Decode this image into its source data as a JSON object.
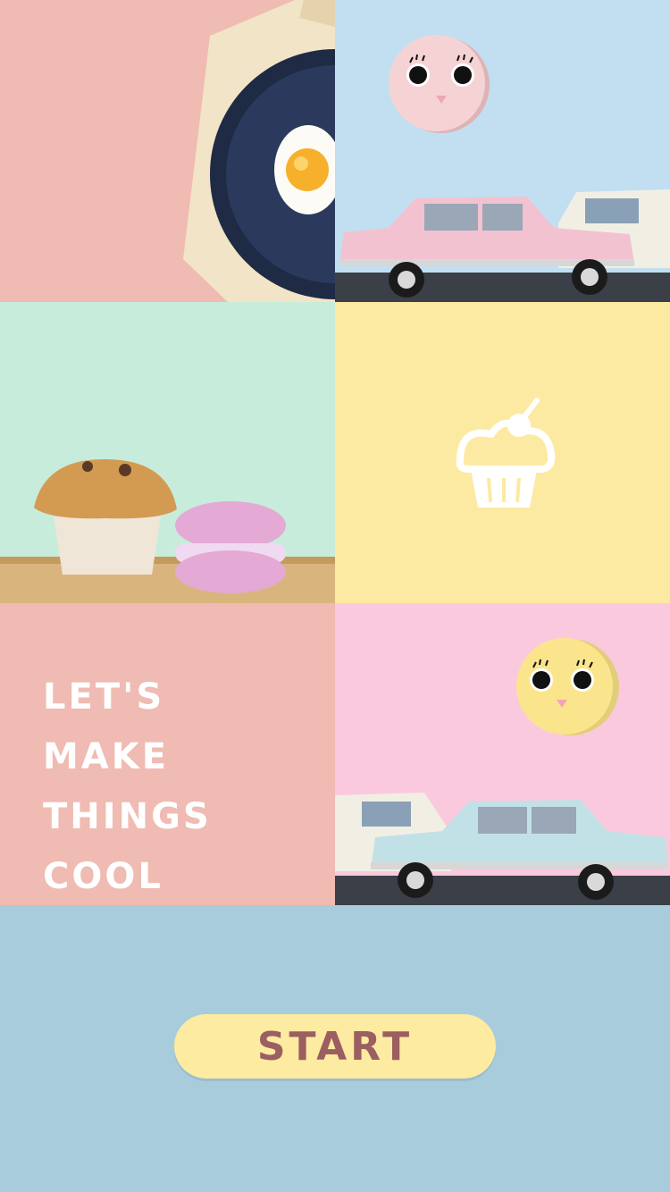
{
  "colors": {
    "tile_egg": "#efbbb2",
    "tile_car_pink": "#c1dff0",
    "tile_muffin": "#c7ecdc",
    "tile_cupcake": "#fdeaa2",
    "tile_text": "#efbbb2",
    "tile_car_blue": "#fbc9dd",
    "bottom": "#a8ccdc",
    "start_button": "#fdeba1",
    "start_text": "#9b5e61"
  },
  "icons": {
    "egg_pan": "fried-egg-pan-icon",
    "owl_pink": "pink-owl-icon",
    "car_pink": "pink-car-icon",
    "muffin": "muffin-icon",
    "macaron": "macaron-icon",
    "cupcake": "cupcake-icon",
    "owl_yellow": "yellow-owl-icon",
    "car_blue": "blue-car-icon"
  },
  "headline": {
    "line1": "LET'S",
    "line2": "MAKE",
    "line3": "THINGS COOL"
  },
  "start_button": {
    "label": "START"
  }
}
